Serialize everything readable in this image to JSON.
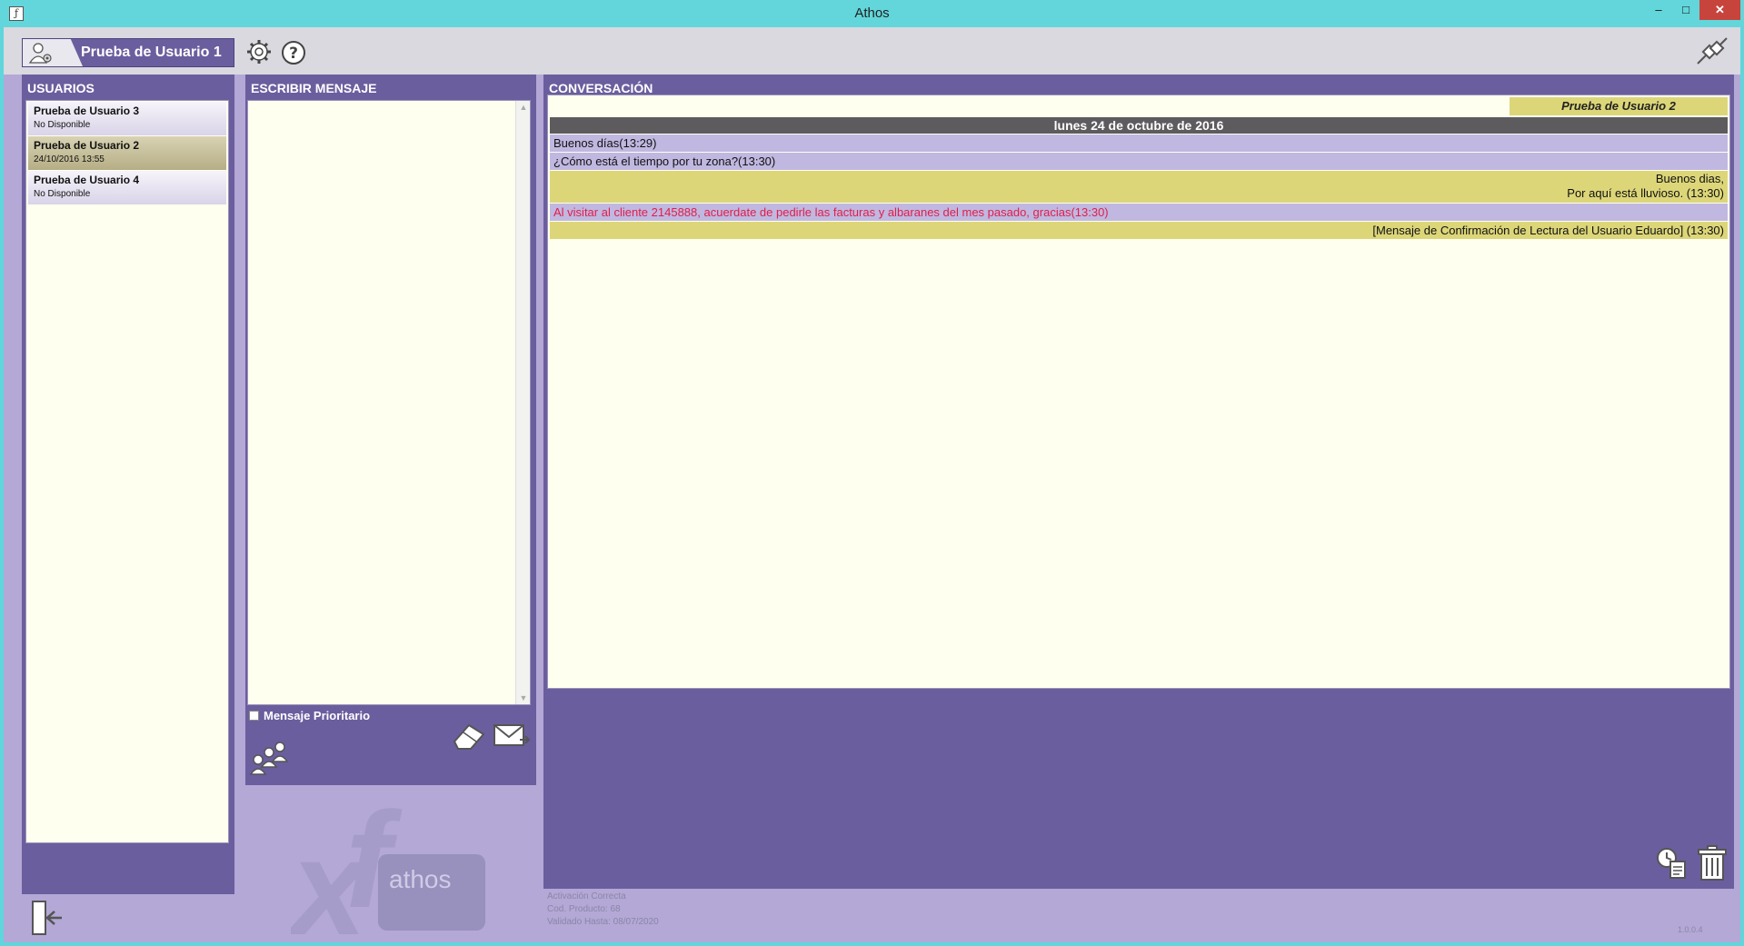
{
  "window": {
    "title": "Athos",
    "min_glyph": "–",
    "max_glyph": "□",
    "close_glyph": "✕"
  },
  "header": {
    "current_user": "Prueba de Usuario 1",
    "icons": [
      "user-settings-icon",
      "gear-icon",
      "help-icon",
      "disconnect-plug-icon"
    ]
  },
  "users_panel": {
    "title": "USUARIOS",
    "users": [
      {
        "name": "Prueba de Usuario 3",
        "status": "No Disponible",
        "selected": false
      },
      {
        "name": "Prueba de Usuario 2",
        "status": "24/10/2016 13:55",
        "selected": true
      },
      {
        "name": "Prueba de Usuario 4",
        "status": "No Disponible",
        "selected": false
      }
    ]
  },
  "compose_panel": {
    "title": "ESCRIBIR MENSAJE",
    "message_value": "",
    "priority_label": "Mensaje Prioritario",
    "priority_checked": false
  },
  "conversation_panel": {
    "title": "CONVERSACIÓN",
    "recipient": "Prueba de Usuario 2",
    "date": "lunes 24 de octubre de 2016",
    "messages": [
      {
        "direction": "in",
        "priority": false,
        "lines": [
          "Buenos días(13:29)"
        ]
      },
      {
        "direction": "in",
        "priority": false,
        "lines": [
          "¿Cómo está el tiempo por tu zona?(13:30)"
        ]
      },
      {
        "direction": "out",
        "priority": false,
        "lines": [
          "Buenos dias,",
          "Por aquí está lluvioso. (13:30)"
        ]
      },
      {
        "direction": "in",
        "priority": true,
        "lines": [
          "Al visitar al cliente 2145888, acuerdate de pedirle las facturas y albaranes del mes pasado, gracias(13:30)"
        ]
      },
      {
        "direction": "out",
        "priority": false,
        "lines": [
          "[Mensaje de Confirmación de Lectura del Usuario Eduardo] (13:30)"
        ]
      }
    ]
  },
  "footer": {
    "activation": "Activación Correcta",
    "product_code": "Cod. Producto: 68",
    "valid_until": "Validado Hasta: 08/07/2020",
    "version": "1.0.0.4",
    "logo_text": "athos"
  },
  "colors": {
    "panel": "#6b5e9e",
    "background": "#b3a8d6",
    "outgoing": "#dcd679",
    "incoming": "#c0b8e0",
    "priority_text": "#e01e4a",
    "titlebar": "#62d6da"
  }
}
